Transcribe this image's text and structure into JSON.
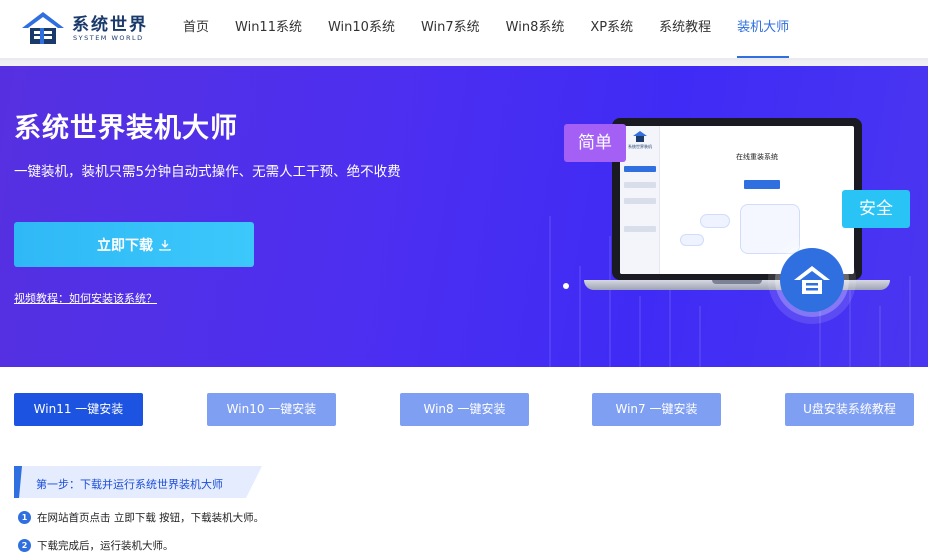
{
  "logo": {
    "title": "系统世界",
    "subtitle": "SYSTEM WORLD"
  },
  "nav": {
    "items": [
      {
        "label": "首页"
      },
      {
        "label": "Win11系统"
      },
      {
        "label": "Win10系统"
      },
      {
        "label": "Win7系统"
      },
      {
        "label": "Win8系统"
      },
      {
        "label": "XP系统"
      },
      {
        "label": "系统教程"
      },
      {
        "label": "装机大师",
        "active": true
      }
    ]
  },
  "hero": {
    "title": "系统世界装机大师",
    "subtitle": "一键装机，装机只需5分钟自动式操作、无需人工干预、绝不收费",
    "download_label": "立即下载",
    "video_link": "视频教程：如何安装该系统？",
    "tag_simple": "简单",
    "tag_safe": "安全",
    "screen_title": "在线重装系统",
    "screen_logo": "系统世界装机"
  },
  "tabs": [
    {
      "label": "Win11 一键安装",
      "active": true
    },
    {
      "label": "Win10 一键安装"
    },
    {
      "label": "Win8 一键安装"
    },
    {
      "label": "Win7 一键安装"
    },
    {
      "label": "U盘安装系统教程"
    }
  ],
  "steps": {
    "title": "第一步：下载并运行系统世界装机大师",
    "items": [
      {
        "num": "1",
        "text": "在网站首页点击 立即下载 按钮，下载装机大师。"
      },
      {
        "num": "2",
        "text": "下载完成后，运行装机大师。"
      }
    ]
  },
  "colors": {
    "accent": "#2f6fe0",
    "hero_bg": "#4d2ff0",
    "download_btn": "#35bff8",
    "tab_active": "#1c53e0",
    "tab_inactive": "#7f9ff2",
    "tag_simple": "#a45ff5",
    "tag_safe": "#29c3f6"
  }
}
